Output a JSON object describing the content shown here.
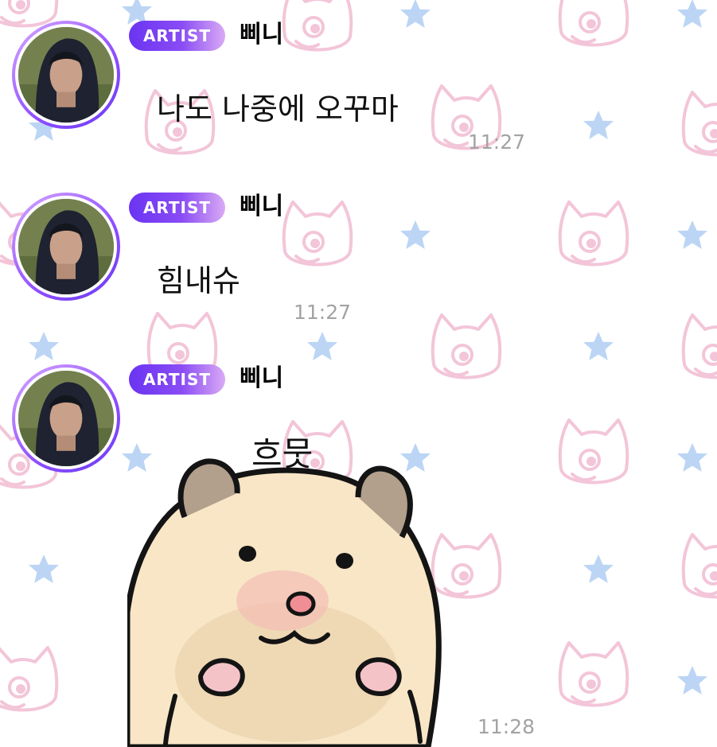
{
  "messages": [
    {
      "badge": "ARTIST",
      "sender": "삐니",
      "text": "나도 나중에 오꾸마",
      "time": "11:27"
    },
    {
      "badge": "ARTIST",
      "sender": "삐니",
      "text": "힘내슈",
      "time": "11:27"
    },
    {
      "badge": "ARTIST",
      "sender": "삐니",
      "sticker_caption": "흐뭇",
      "time": "11:28"
    }
  ],
  "colors": {
    "badge_start": "#6a34f2",
    "badge_end": "#d9aaf5",
    "timestamp": "#a3a3a3",
    "cat_pattern": "#f4c9dc",
    "star_pattern": "#bcd5f5"
  },
  "icons": [
    "cat-face-icon",
    "star-icon",
    "hamster-sticker"
  ]
}
